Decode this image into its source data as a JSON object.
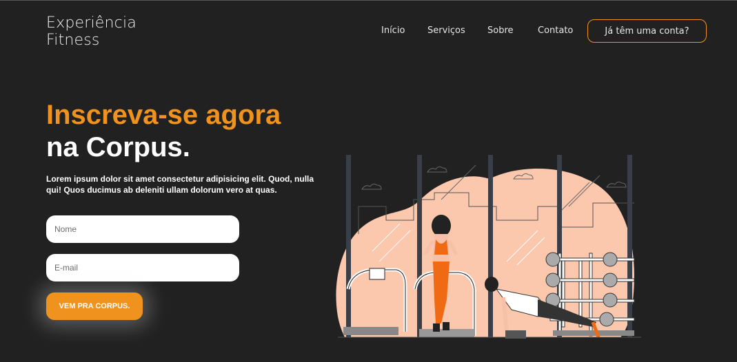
{
  "brand": {
    "line1": "Experiência",
    "line2": "Fitness"
  },
  "nav": {
    "items": [
      "Início",
      "Serviços",
      "Sobre",
      "Contato"
    ],
    "login_label": "Já têm uma conta?"
  },
  "hero": {
    "title_highlight": "Inscreva-se agora",
    "title_rest": "na Corpus.",
    "description": "Lorem ipsum dolor sit amet consectetur adipisicing elit. Quod, nulla qui! Quos ducimus ab deleniti ullam dolorum vero at quas."
  },
  "form": {
    "name_placeholder": "Nome",
    "email_placeholder": "E-mail",
    "submit_label": "VEM PRA CORPUS."
  },
  "colors": {
    "background": "#212121",
    "accent": "#f0931e",
    "illustration_blob": "#fbc7ad",
    "illustration_orange": "#f06a14"
  }
}
